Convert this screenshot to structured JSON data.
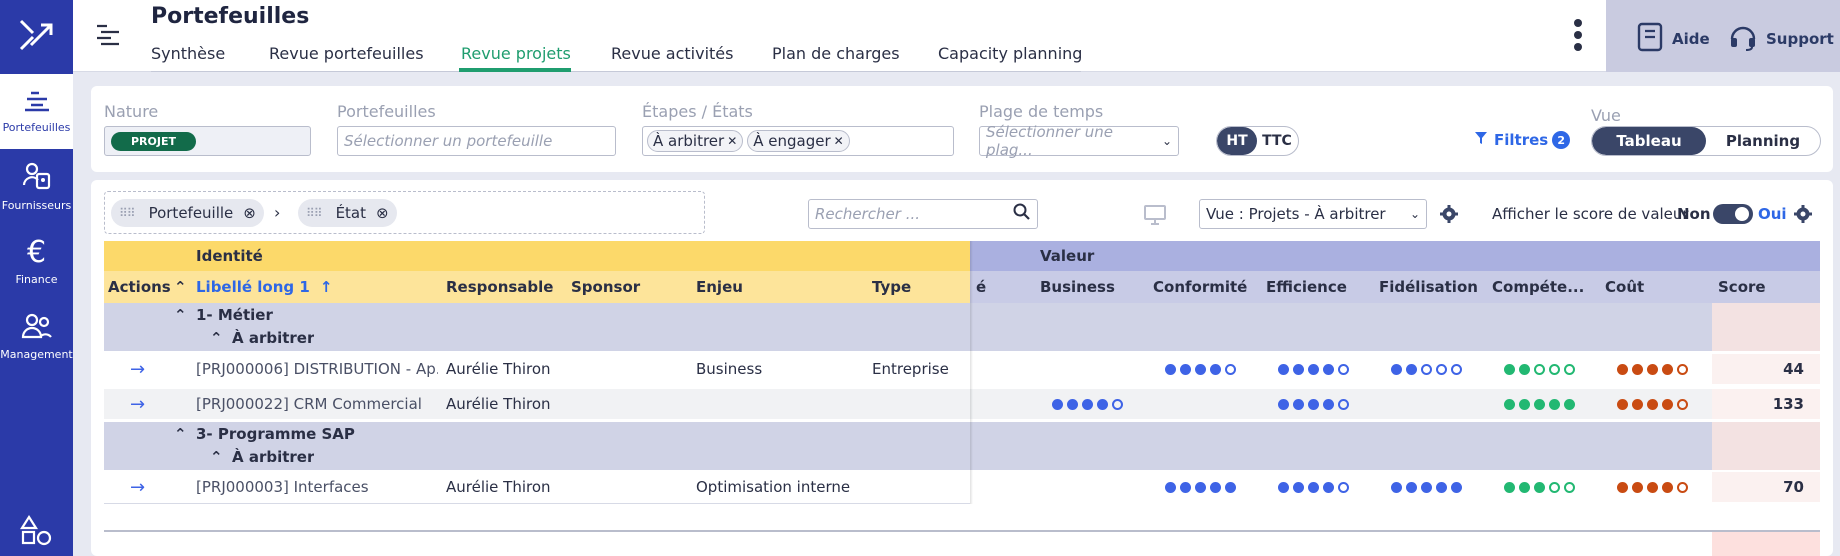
{
  "app": {
    "title": "Portefeuilles"
  },
  "tabs": [
    "Synthèse",
    "Revue portefeuilles",
    "Revue projets",
    "Revue activités",
    "Plan de charges",
    "Capacity planning"
  ],
  "sidebar": [
    {
      "label": "Portefeuilles",
      "icon": "portfolio-icon"
    },
    {
      "label": "Fournisseurs",
      "icon": "supplier-icon"
    },
    {
      "label": "Finance",
      "icon": "euro-icon"
    },
    {
      "label": "Management",
      "icon": "people-icon"
    }
  ],
  "header_right": {
    "aide": "Aide",
    "support": "Support"
  },
  "filters": {
    "nature_label": "Nature",
    "nature_chip": "PROJET",
    "portefeuilles_label": "Portefeuilles",
    "portefeuilles_placeholder": "Sélectionner un portefeuille",
    "etapes_label": "Étapes / États",
    "etapes_chips": [
      "À arbitrer",
      "À engager"
    ],
    "plage_label": "Plage de temps",
    "plage_placeholder": "Sélectionner une plag...",
    "ht": "HT",
    "ttc": "TTC",
    "filtres": "Filtres",
    "filtres_count": "2",
    "vue_label": "Vue",
    "vue_tableau": "Tableau",
    "vue_planning": "Planning"
  },
  "toolbar": {
    "group1": "Portefeuille",
    "group2": "État",
    "search_placeholder": "Rechercher ...",
    "vue_select": "Vue : Projets - À arbitrer",
    "score_label": "Afficher le score de valeur",
    "non": "Non",
    "oui": "Oui"
  },
  "table": {
    "group_identite": "Identité",
    "group_valeur": "Valeur",
    "columns": {
      "actions": "Actions",
      "libelle": "Libellé long 1",
      "responsable": "Responsable",
      "sponsor": "Sponsor",
      "enjeu": "Enjeu",
      "type": "Type",
      "hidden": "é",
      "business": "Business",
      "conformite": "Conformité",
      "efficience": "Efficience",
      "fidelisation": "Fidélisation",
      "competence": "Compéte...",
      "cout": "Coût",
      "score": "Score"
    },
    "groups": [
      {
        "name": "1- Métier",
        "sub": "À arbitrer",
        "rows": [
          {
            "libelle": "[PRJ000006] DISTRIBUTION - Ap...",
            "responsable": "Aurélie Thiron",
            "enjeu": "Business",
            "type": "Entreprise",
            "business": null,
            "conformite": 4,
            "efficience": 4,
            "fidelisation": 2,
            "competence": 2,
            "cout": 4,
            "score": "44"
          },
          {
            "libelle": "[PRJ000022] CRM Commercial",
            "responsable": "Aurélie Thiron",
            "enjeu": "",
            "type": "",
            "business": 4,
            "conformite": null,
            "efficience": 4,
            "fidelisation": null,
            "competence": 5,
            "cout": 4,
            "score": "133"
          }
        ]
      },
      {
        "name": "3- Programme SAP",
        "sub": "À arbitrer",
        "rows": [
          {
            "libelle": "[PRJ000003] Interfaces",
            "responsable": "Aurélie Thiron",
            "enjeu": "Optimisation interne",
            "type": "",
            "business": null,
            "conformite": 5,
            "efficience": 4,
            "fidelisation": 5,
            "competence": 3,
            "cout": 4,
            "score": "70"
          }
        ]
      }
    ]
  },
  "colors": {
    "blue": "#3e63e6",
    "green": "#22b872",
    "orange": "#c94b12",
    "brand": "#2b3aa8",
    "accent": "#1f9d6f"
  }
}
